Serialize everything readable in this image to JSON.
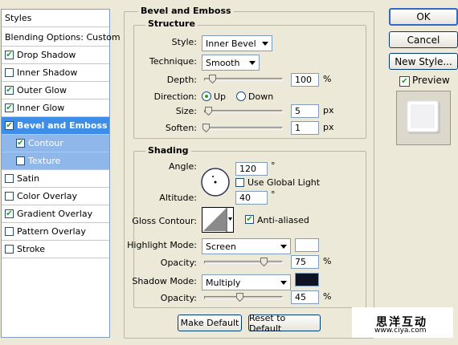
{
  "style_list": {
    "header": "Styles",
    "items": [
      {
        "label": "Blending Options: Custom",
        "checkbox": false,
        "checked": false,
        "state": "normal"
      },
      {
        "label": "Drop Shadow",
        "checkbox": true,
        "checked": true,
        "state": "normal"
      },
      {
        "label": "Inner Shadow",
        "checkbox": true,
        "checked": false,
        "state": "normal"
      },
      {
        "label": "Outer Glow",
        "checkbox": true,
        "checked": true,
        "state": "normal"
      },
      {
        "label": "Inner Glow",
        "checkbox": true,
        "checked": true,
        "state": "normal"
      },
      {
        "label": "Bevel and Emboss",
        "checkbox": true,
        "checked": true,
        "state": "selected"
      },
      {
        "label": "Contour",
        "checkbox": true,
        "checked": true,
        "state": "sub"
      },
      {
        "label": "Texture",
        "checkbox": true,
        "checked": false,
        "state": "sub"
      },
      {
        "label": "Satin",
        "checkbox": true,
        "checked": false,
        "state": "normal"
      },
      {
        "label": "Color Overlay",
        "checkbox": true,
        "checked": false,
        "state": "normal"
      },
      {
        "label": "Gradient Overlay",
        "checkbox": true,
        "checked": true,
        "state": "normal"
      },
      {
        "label": "Pattern Overlay",
        "checkbox": true,
        "checked": false,
        "state": "normal"
      },
      {
        "label": "Stroke",
        "checkbox": true,
        "checked": false,
        "state": "normal"
      }
    ]
  },
  "bevel": {
    "title": "Bevel and Emboss",
    "structure": {
      "title": "Structure",
      "style_label": "Style:",
      "style_value": "Inner Bevel",
      "technique_label": "Technique:",
      "technique_value": "Smooth",
      "depth_label": "Depth:",
      "depth_value": "100",
      "depth_unit": "%",
      "depth_level": 0.1,
      "direction_label": "Direction:",
      "dir_up": "Up",
      "dir_down": "Down",
      "direction_selected": "Up",
      "size_label": "Size:",
      "size_value": "5",
      "size_unit": "px",
      "size_level": 0.05,
      "soften_label": "Soften:",
      "soften_value": "1",
      "soften_unit": "px",
      "soften_level": 0.02
    },
    "shading": {
      "title": "Shading",
      "angle_label": "Angle:",
      "angle_value": "120",
      "angle_unit": "°",
      "global_light_label": "Use Global Light",
      "global_light_checked": false,
      "altitude_label": "Altitude:",
      "altitude_value": "40",
      "altitude_unit": "°",
      "gloss_label": "Gloss Contour:",
      "anti_aliased_label": "Anti-aliased",
      "anti_aliased_checked": true,
      "highlight_mode_label": "Highlight Mode:",
      "highlight_mode_value": "Screen",
      "highlight_color": "#ffffff",
      "highlight_opacity_label": "Opacity:",
      "highlight_opacity_value": "75",
      "highlight_opacity_unit": "%",
      "highlight_opacity_level": 0.75,
      "shadow_mode_label": "Shadow Mode:",
      "shadow_mode_value": "Multiply",
      "shadow_color": "#0e1324",
      "shadow_opacity_label": "Opacity:",
      "shadow_opacity_value": "45",
      "shadow_opacity_unit": "%",
      "shadow_opacity_level": 0.45
    },
    "make_default": "Make Default",
    "reset_default": "Reset to Default"
  },
  "buttons": {
    "ok": "OK",
    "cancel": "Cancel",
    "new_style": "New Style...",
    "preview_label": "Preview",
    "preview_checked": true
  },
  "watermark": {
    "text_cn": "思洋互动",
    "url": "www.ciya.com"
  }
}
